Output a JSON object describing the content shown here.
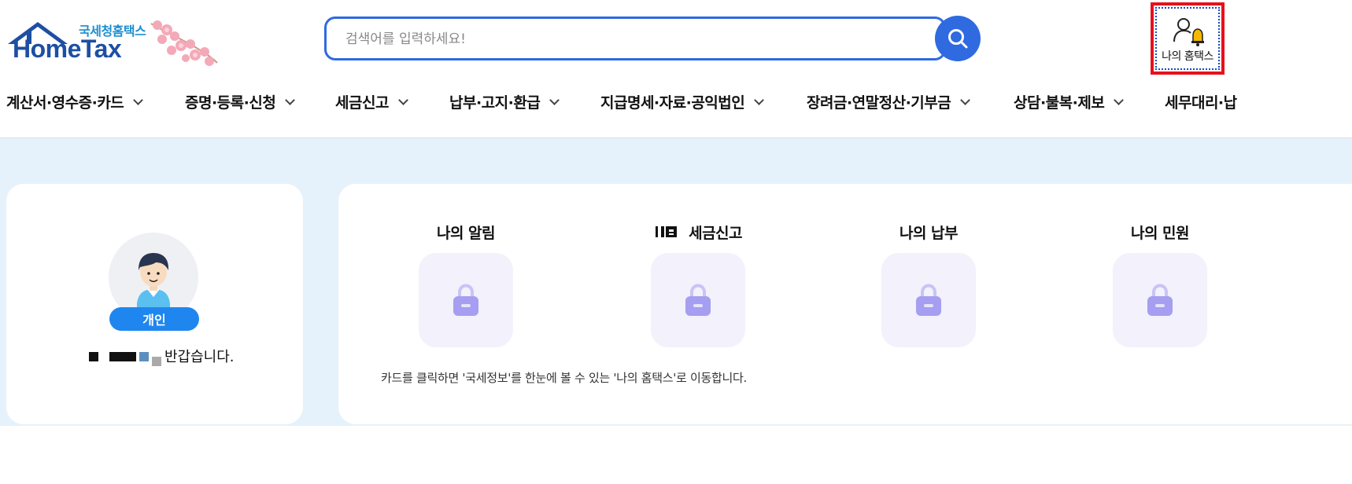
{
  "header": {
    "logo": {
      "subtitle": "국세청홈택스",
      "title": "HomeTax"
    },
    "search": {
      "placeholder": "검색어를 입력하세요!"
    },
    "my_hometax": {
      "label": "나의 홈택스"
    }
  },
  "nav": {
    "items": [
      {
        "label": "계산서·영수증·카드"
      },
      {
        "label": "증명·등록·신청"
      },
      {
        "label": "세금신고"
      },
      {
        "label": "납부·고지·환급"
      },
      {
        "label": "지급명세·자료·공익법인"
      },
      {
        "label": "장려금·연말정산·기부금"
      },
      {
        "label": "상담·불복·제보"
      },
      {
        "label": "세무대리·납"
      }
    ]
  },
  "profile": {
    "type_badge": "개인",
    "greeting_suffix": "반갑습니다."
  },
  "cards": {
    "items": [
      {
        "title": "나의 알림"
      },
      {
        "title": "세금신고"
      },
      {
        "title": "나의 납부"
      },
      {
        "title": "나의 민원"
      }
    ],
    "note": "카드를 클릭하면 '국세정보'를 한눈에 볼 수 있는 '나의 홈택스'로 이동합니다."
  },
  "colors": {
    "brand_blue": "#1d4fa3",
    "search_blue": "#2f6ae0",
    "badge_blue": "#1f86f0",
    "highlight_red": "#e8101c",
    "lock_purple": "#a9a3ee",
    "main_bg": "#e5f2fb"
  },
  "icons": {
    "search": "search-icon",
    "my_hometax": "user-bell-icon",
    "nav_chevron": "chevron-down-icon",
    "card_lock": "lock-icon",
    "avatar": "person-avatar-icon"
  }
}
